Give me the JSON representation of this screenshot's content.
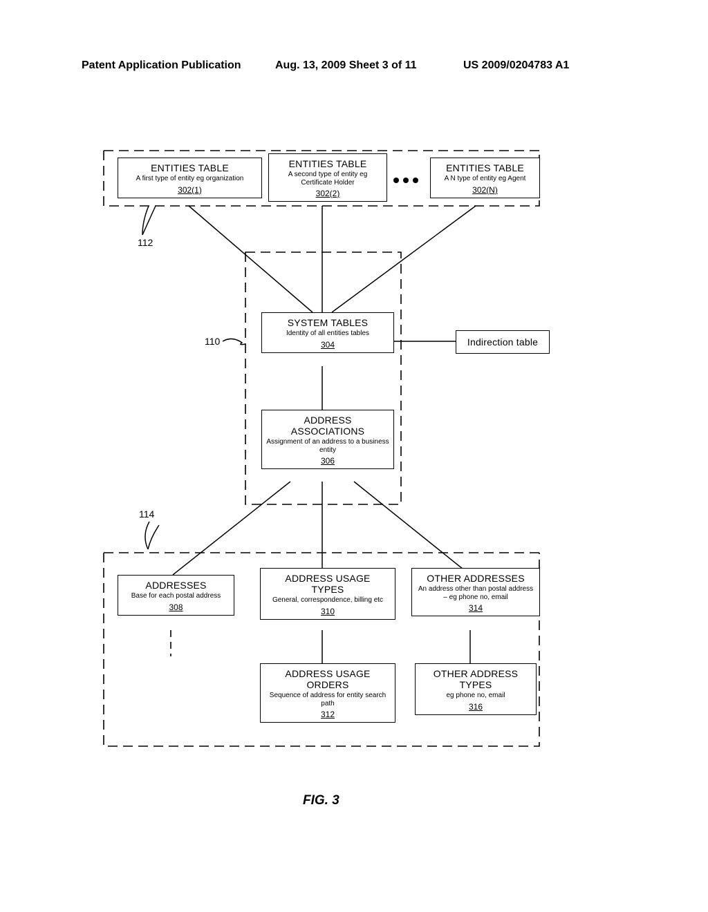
{
  "header": {
    "left": "Patent Application Publication",
    "mid": "Aug. 13, 2009  Sheet 3 of 11",
    "right": "US 2009/0204783 A1"
  },
  "boxes": {
    "ent1": {
      "title": "ENTITIES TABLE",
      "sub": "A first type of entity eg organization",
      "ref": "302(1)"
    },
    "ent2": {
      "title": "ENTITIES TABLE",
      "sub": "A second type of entity eg Certificate Holder",
      "ref": "302(2)"
    },
    "entN": {
      "title": "ENTITIES TABLE",
      "sub": "A N type of entity eg Agent",
      "ref": "302(N)"
    },
    "sys": {
      "title": "SYSTEM TABLES",
      "sub": "Identity of all entities tables",
      "ref": "304"
    },
    "assoc": {
      "title": "ADDRESS ASSOCIATIONS",
      "sub": "Assignment of an address to a business entity",
      "ref": "306"
    },
    "addr": {
      "title": "ADDRESSES",
      "sub": "Base for each postal address",
      "ref": "308"
    },
    "usaget": {
      "title": "ADDRESS USAGE TYPES",
      "sub": "General, correspondence, billing etc",
      "ref": "310"
    },
    "oaddr": {
      "title": "OTHER ADDRESSES",
      "sub": "An address other than postal address – eg phone no, email",
      "ref": "314"
    },
    "usageo": {
      "title": "ADDRESS USAGE ORDERS",
      "sub": "Sequence of address for entity search path",
      "ref": "312"
    },
    "oatype": {
      "title": "OTHER ADDRESS TYPES",
      "sub": "eg phone no, email",
      "ref": "316"
    },
    "indir": {
      "title": "Indirection table"
    }
  },
  "labels": {
    "l112": "112",
    "l110": "110",
    "l114": "114"
  },
  "figure": "FIG. 3"
}
